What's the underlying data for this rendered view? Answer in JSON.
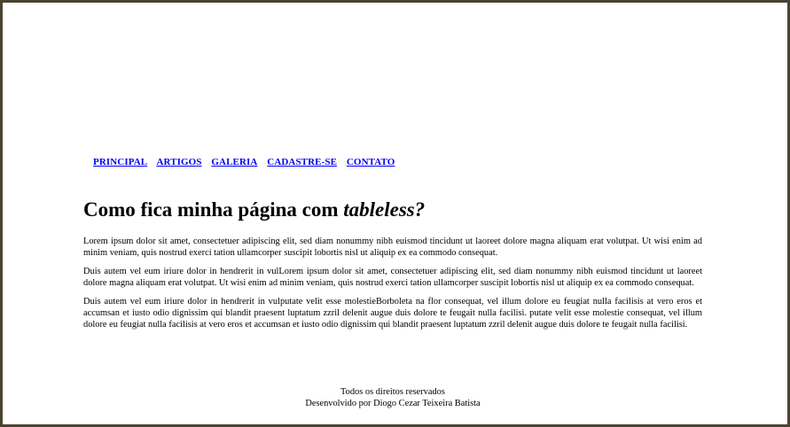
{
  "nav": {
    "items": [
      {
        "label": "PRINCIPAL"
      },
      {
        "label": "ARTIGOS"
      },
      {
        "label": "GALERIA"
      },
      {
        "label": "CADASTRE-SE"
      },
      {
        "label": "CONTATO"
      }
    ]
  },
  "article": {
    "title_prefix": "Como fica minha página com ",
    "title_emphasis": "tableless?",
    "paragraphs": [
      "Lorem ipsum dolor sit amet, consectetuer adipiscing elit, sed diam nonummy nibh euismod tincidunt ut laoreet dolore magna aliquam erat volutpat. Ut wisi enim ad minim veniam, quis nostrud exerci tation ullamcorper suscipit lobortis nisl ut aliquip ex ea commodo consequat.",
      "Duis autem vel eum iriure dolor in hendrerit in vulLorem ipsum dolor sit amet, consectetuer adipiscing elit, sed diam nonummy nibh euismod tincidunt ut laoreet dolore magna aliquam erat volutpat. Ut wisi enim ad minim veniam, quis nostrud exerci tation ullamcorper suscipit lobortis nisl ut aliquip ex ea commodo consequat.",
      "Duis autem vel eum iriure dolor in hendrerit in vulputate velit esse molestieBorboleta na flor consequat, vel illum dolore eu feugiat nulla facilisis at vero eros et accumsan et iusto odio dignissim qui blandit praesent luptatum zzril delenit augue duis dolore te feugait nulla facilisi. putate velit esse molestie consequat, vel illum dolore eu feugiat nulla facilisis at vero eros et accumsan et iusto odio dignissim qui blandit praesent luptatum zzril delenit augue duis dolore te feugait nulla facilisi."
    ]
  },
  "footer": {
    "line1": "Todos os direitos reservados",
    "line2": "Desenvolvido por Diogo Cezar Teixeira Batista"
  },
  "colors": {
    "frame": "#4a4330",
    "link": "#0000ee",
    "text": "#000000",
    "background": "#ffffff"
  }
}
